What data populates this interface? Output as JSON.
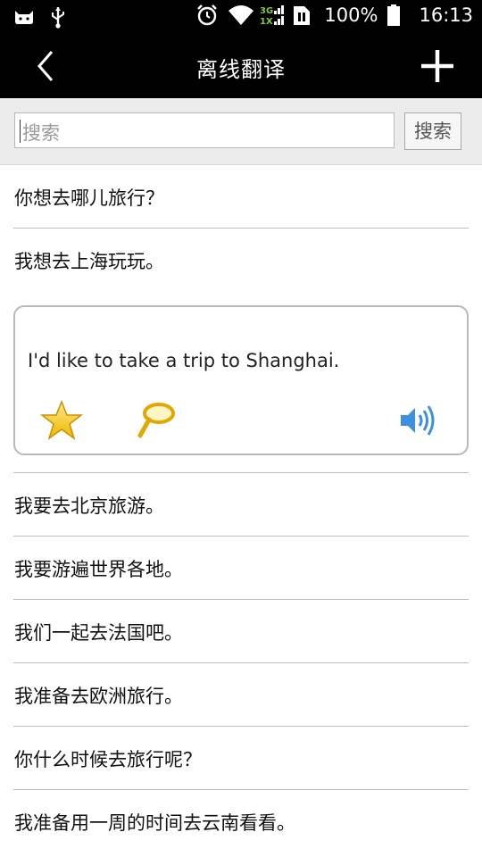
{
  "status_bar": {
    "battery": "100%",
    "time": "16:13",
    "network": "3G 1X"
  },
  "header": {
    "title": "离线翻译",
    "back_icon": "chevron-left-icon",
    "add_icon": "plus-icon"
  },
  "search": {
    "placeholder": "搜索",
    "button_label": "搜索"
  },
  "list": {
    "items": [
      "你想去哪儿旅行？",
      "我想去上海玩玩。",
      "我要去北京旅游。",
      "我要游遍世界各地。",
      "我们一起去法国吧。",
      "我准备去欧洲旅行。",
      "你什么时候去旅行呢？",
      "我准备用一周的时间去云南看看。"
    ]
  },
  "translation_card": {
    "text": "I'd like to take a trip to Shanghai.",
    "icons": [
      "star-icon",
      "magnifier-icon",
      "speaker-icon"
    ],
    "accent": "#3d8fe0"
  }
}
